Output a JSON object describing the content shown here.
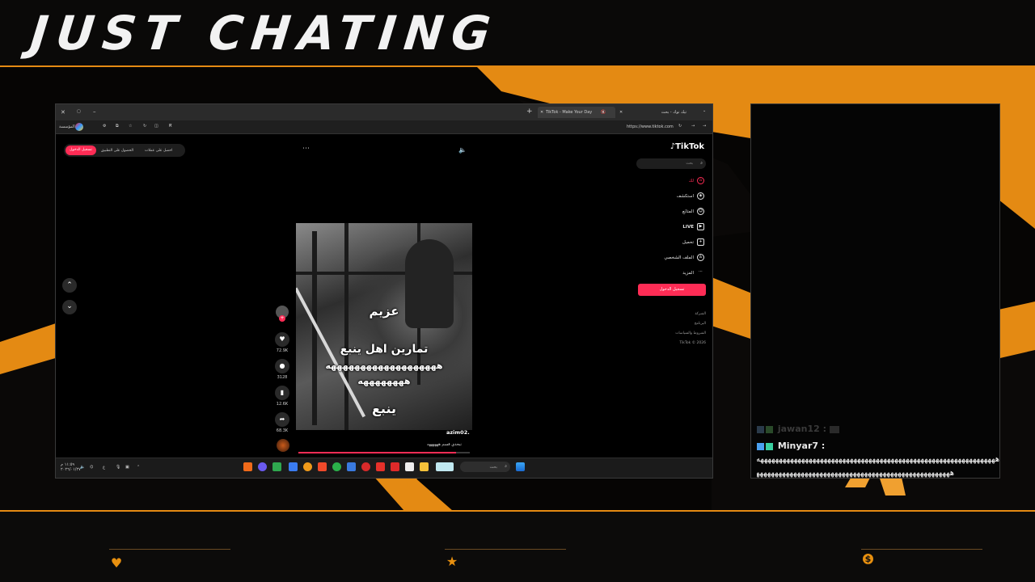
{
  "overlay": {
    "title": "JUST CHATING",
    "accent_color": "#e48a13",
    "bottom_icons": [
      "heart-icon",
      "star-icon",
      "dollar-icon"
    ]
  },
  "browser": {
    "tabs": [
      {
        "label": "تيك توك - بحث",
        "active": false
      },
      {
        "label": "TikTok - Make Your Day",
        "active": true
      }
    ],
    "url": "https://www.tiktok.com",
    "profile_label": "المؤسسة"
  },
  "tiktok": {
    "logo": "TikTok",
    "search_placeholder": "بحث",
    "nav": [
      {
        "label": "لك",
        "icon": "home-icon",
        "active": true
      },
      {
        "label": "استكشف",
        "icon": "compass-icon"
      },
      {
        "label": "المتابَع",
        "icon": "following-icon"
      },
      {
        "label": "LIVE",
        "icon": "live-icon"
      },
      {
        "label": "تحميل",
        "icon": "upload-icon"
      },
      {
        "label": "الملف الشخصي",
        "icon": "profile-icon"
      },
      {
        "label": "المزيد",
        "icon": "more-icon"
      }
    ],
    "login_label": "تسجيل الدخول",
    "footer": [
      "الشركة",
      "البرنامج",
      "الشروط والسياسات",
      "TikTok © 2026"
    ],
    "top_actions": {
      "get_coins": "احصل على عملات",
      "get_app": "الحصول على التطبيق",
      "login": "تسجيل الدخول"
    },
    "video": {
      "captions": [
        "عزيم",
        "تمارين اهل ينبع",
        "هههههههههههههههههههه",
        "ههههههههه",
        "ينبع"
      ],
      "author": "azim02.",
      "description": "تبحدي قسم ههههههه"
    },
    "actions": [
      {
        "icon": "heart-icon",
        "count": "72.9K"
      },
      {
        "icon": "comment-icon",
        "count": "3128"
      },
      {
        "icon": "bookmark-icon",
        "count": "12.6K"
      },
      {
        "icon": "share-icon",
        "count": "68.3K"
      }
    ]
  },
  "taskbar": {
    "search_placeholder": "بحث",
    "time": "١١:٥٩ م",
    "date": "٢٠٢٦/٠١/٢٧",
    "lang": "ع"
  },
  "chat": {
    "messages": [
      {
        "user": "jawan12 :",
        "text": "",
        "faded": true
      },
      {
        "user": "Minyar7 :",
        "text": "ههههههههههههههههههههههههههههههههههههههههههههههههههههههههههههههههه",
        "faded": false
      }
    ],
    "continuation": "هههههههههههههههههههههههههههههههههههههههههههههههههههههههه"
  }
}
